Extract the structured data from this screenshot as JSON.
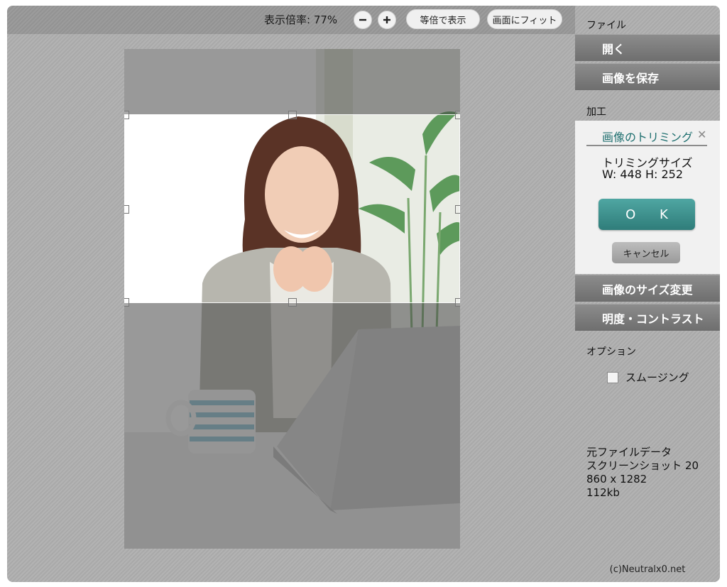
{
  "toolbar": {
    "zoom_label": "表示倍率: 77%",
    "zoom_out_icon": "minus-icon",
    "zoom_in_icon": "plus-icon",
    "actual_size_label": "等倍で表示",
    "fit_label": "画面にフィット"
  },
  "sidebar": {
    "file_section": "ファイル",
    "open_label": "開く",
    "save_label": "画像を保存",
    "edit_section": "加工",
    "trim_panel": {
      "title": "画像のトリミング",
      "close_icon": "close-icon",
      "size_label": "トリミングサイズ",
      "size_values": "W: 448  H: 252",
      "ok_label": "O K",
      "cancel_label": "キャンセル"
    },
    "resize_label": "画像のサイズ変更",
    "brightness_label": "明度・コントラスト",
    "options_section": "オプション",
    "smoothing_label": "スムージング",
    "smoothing_checked": false,
    "original_data": {
      "heading": "元ファイルデータ",
      "filename": "スクリーンショット 20",
      "dimensions": "860 x 1282",
      "filesize": "112kb"
    },
    "credit": "(c)Neutralx0.net"
  },
  "colors": {
    "accent": "#3a8f8b",
    "menu_button": "#7d7d7d",
    "panel_bg": "#f1f1f1"
  }
}
